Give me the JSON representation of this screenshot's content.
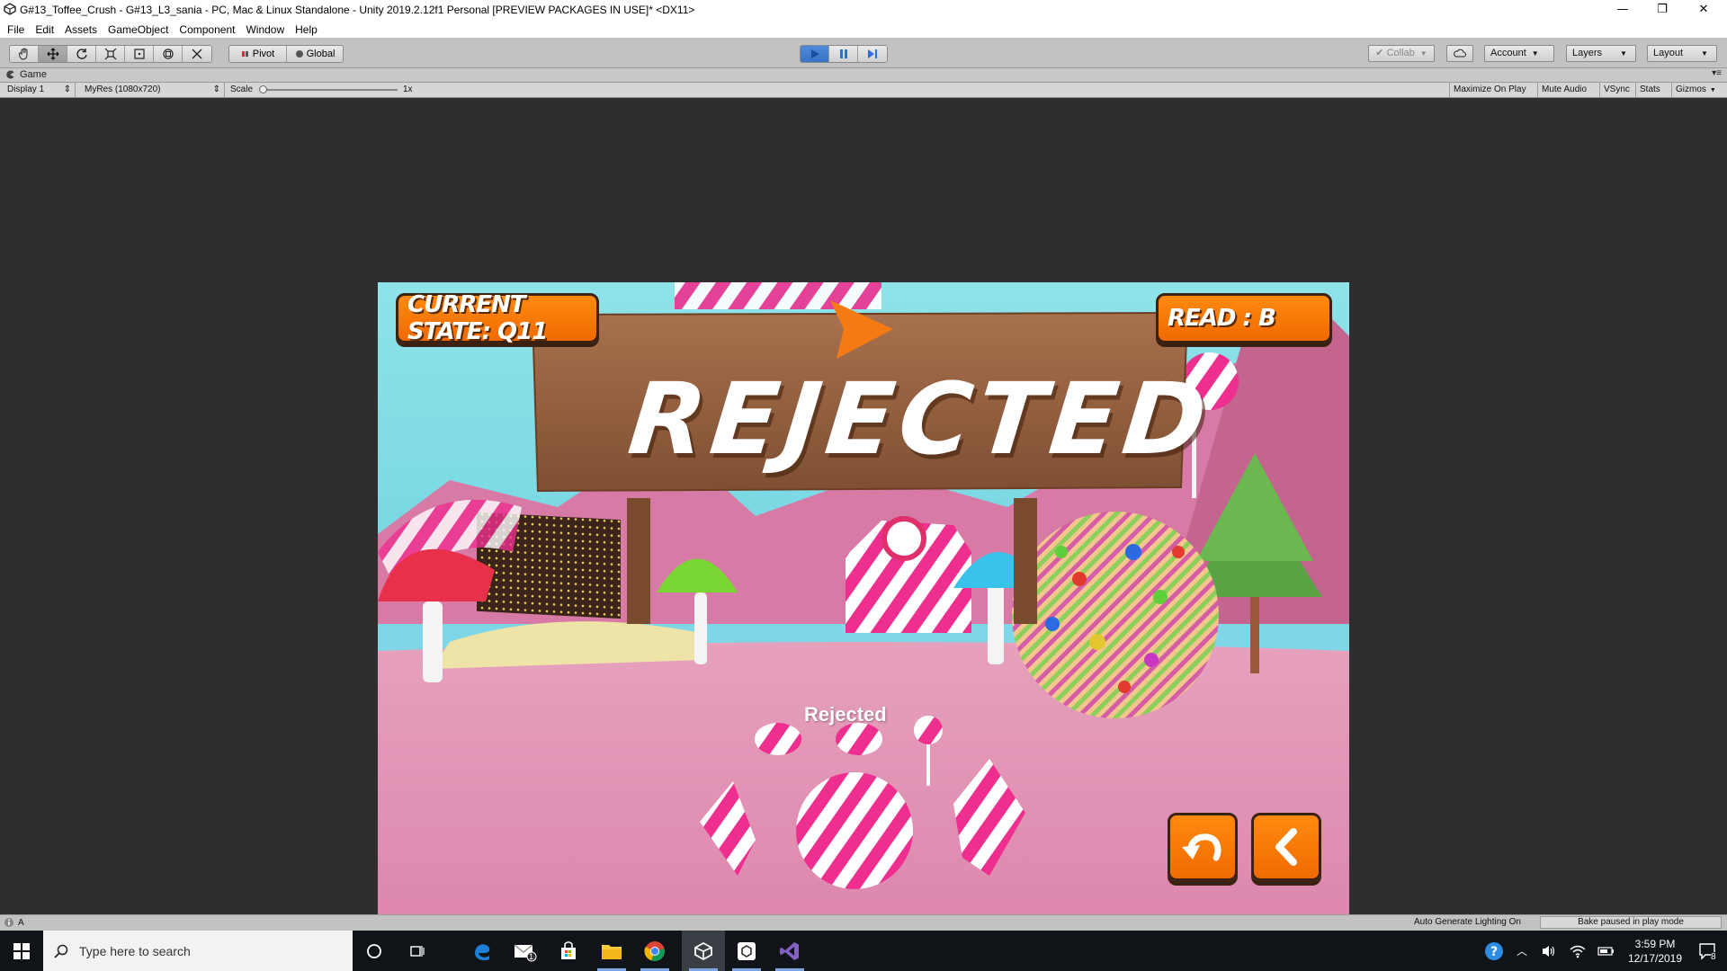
{
  "window": {
    "title": "G#13_Toffee_Crush - G#13_L3_sania - PC, Mac & Linux Standalone - Unity 2019.2.12f1 Personal [PREVIEW PACKAGES IN USE]* <DX11>",
    "minimize": "—",
    "restore": "❐",
    "close": "✕"
  },
  "menu": [
    "File",
    "Edit",
    "Assets",
    "GameObject",
    "Component",
    "Window",
    "Help"
  ],
  "toolbar": {
    "pivot_label": "Pivot",
    "global_label": "Global",
    "collab_label": "Collab",
    "account_label": "Account",
    "layers_label": "Layers",
    "layout_label": "Layout",
    "play_state": "playing"
  },
  "game_tab": {
    "tab_label": "Game",
    "display": "Display 1",
    "resolution": "MyRes (1080x720)",
    "scale_label": "Scale",
    "scale_value": "1x",
    "scale_fraction": 0.0,
    "maximize_on_play": "Maximize On Play",
    "mute_audio": "Mute Audio",
    "vsync": "VSync",
    "stats": "Stats",
    "gizmos": "Gizmos"
  },
  "game": {
    "current_state": "CURRENT STATE: Q11",
    "read": "READ : B",
    "sign_text": "REJECTED",
    "world_label": "Rejected",
    "undo_icon": "undo-icon",
    "back_icon": "chevron-left-icon",
    "colors": {
      "hud_orange": "#f57a00",
      "sky": "#74d9e0",
      "ground": "#e79ab8",
      "wood": "#9b6646"
    }
  },
  "status": {
    "left_text": "A",
    "auto_lighting": "Auto Generate Lighting On",
    "bake_status": "Bake paused in play mode"
  },
  "taskbar": {
    "search_placeholder": "Type here to search",
    "time": "3:59 PM",
    "date": "12/17/2019",
    "notification_count": "8",
    "mail_badge": "1"
  }
}
